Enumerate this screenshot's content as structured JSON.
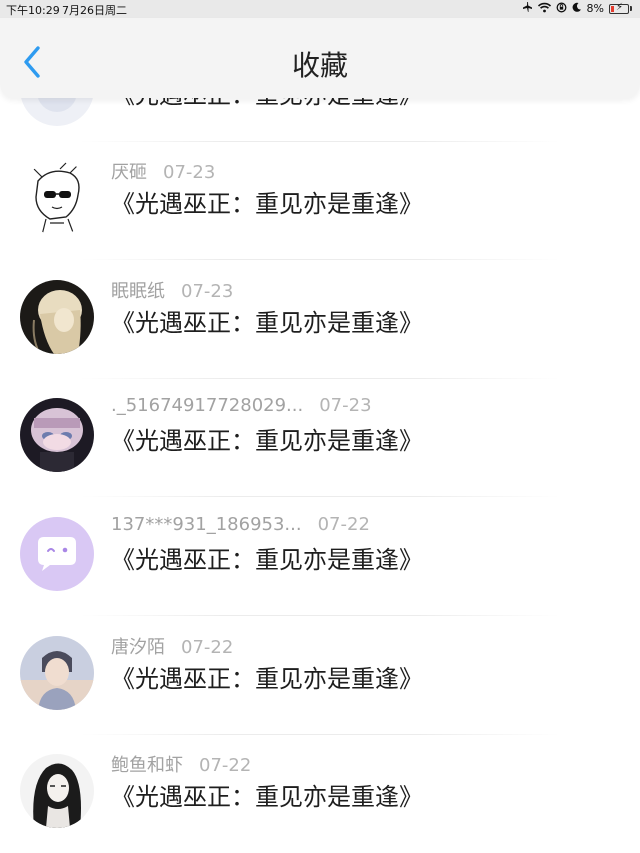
{
  "status_bar": {
    "time": "下午10:29",
    "date": "7月26日周二",
    "battery": "8%",
    "icons": [
      "airplane-icon",
      "wifi-icon",
      "lock-rotation-icon",
      "moon-icon",
      "battery-charging-icon"
    ]
  },
  "nav": {
    "back_icon": "chevron-left-icon",
    "title": "收藏",
    "accent_color": "#2e9bf0"
  },
  "items": [
    {
      "name": "",
      "date": "",
      "text": "《光遇巫正：重见亦是重逢》",
      "avatar": "partial-avatar"
    },
    {
      "name": "厌砸",
      "date": "07-23",
      "text": "《光遇巫正：重见亦是重逢》",
      "avatar": "sketch-girl-avatar"
    },
    {
      "name": "眠眠纸",
      "date": "07-23",
      "text": "《光遇巫正：重见亦是重逢》",
      "avatar": "blonde-figure-avatar"
    },
    {
      "name": "._51674917728029...",
      "date": "07-23",
      "text": "《光遇巫正：重见亦是重逢》",
      "avatar": "anime-girl-avatar"
    },
    {
      "name": "137***931_186953...",
      "date": "07-22",
      "text": "《光遇巫正：重见亦是重逢》",
      "avatar": "default-chat-avatar"
    },
    {
      "name": "唐汐陌",
      "date": "07-22",
      "text": "《光遇巫正：重见亦是重逢》",
      "avatar": "painted-boy-avatar"
    },
    {
      "name": "鲍鱼和虾",
      "date": "07-22",
      "text": "《光遇巫正：重见亦是重逢》",
      "avatar": "dark-hair-girl-avatar"
    }
  ]
}
